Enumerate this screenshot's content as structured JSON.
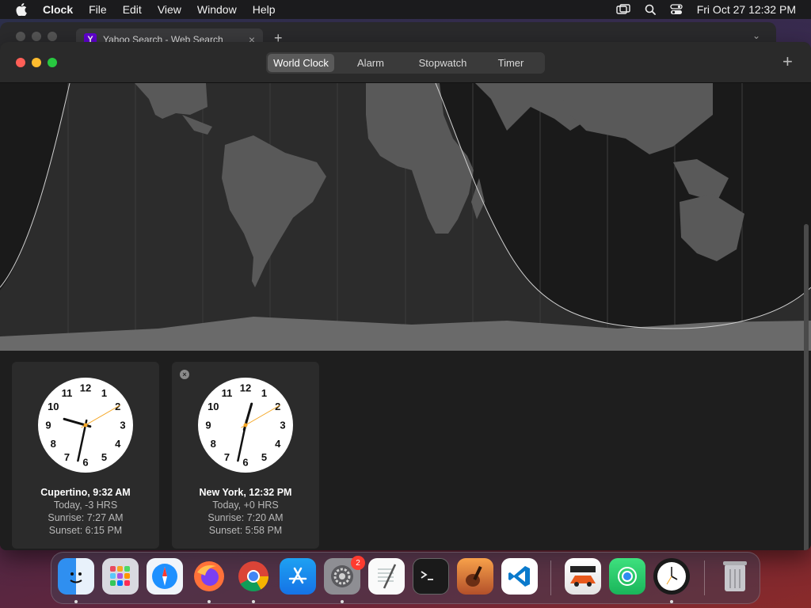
{
  "menubar": {
    "app_name": "Clock",
    "items": [
      "File",
      "Edit",
      "View",
      "Window",
      "Help"
    ],
    "datetime": "Fri Oct 27  12:32 PM"
  },
  "browser": {
    "tab_title": "Yahoo Search - Web Search",
    "tab_icon_letter": "Y",
    "close_glyph": "×",
    "new_tab_glyph": "+"
  },
  "clock_window": {
    "tabs": [
      {
        "label": "World Clock",
        "active": true
      },
      {
        "label": "Alarm",
        "active": false
      },
      {
        "label": "Stopwatch",
        "active": false
      },
      {
        "label": "Timer",
        "active": false
      }
    ],
    "add_glyph": "+",
    "clocks": [
      {
        "city_line": "Cupertino, 9:32 AM",
        "offset_line": "Today, -3 HRS",
        "sunrise_line": "Sunrise: 7:27 AM",
        "sunset_line": "Sunset: 6:15 PM",
        "hour": 9,
        "minute": 32,
        "second": 10
      },
      {
        "city_line": "New York, 12:32 PM",
        "offset_line": "Today, +0 HRS",
        "sunrise_line": "Sunrise: 7:20 AM",
        "sunset_line": "Sunset: 5:58 PM",
        "hour": 12,
        "minute": 32,
        "second": 10
      }
    ]
  },
  "dock": {
    "apps": [
      "finder-icon",
      "launchpad-icon",
      "safari-icon",
      "firefox-icon",
      "chrome-icon",
      "app-store-icon",
      "system-settings-icon",
      "textedit-icon",
      "terminal-icon",
      "garageband-icon",
      "vscode-icon",
      "asphalt-icon",
      "find-my-icon",
      "clock-icon",
      "trash-icon"
    ],
    "settings_badge": "2"
  }
}
